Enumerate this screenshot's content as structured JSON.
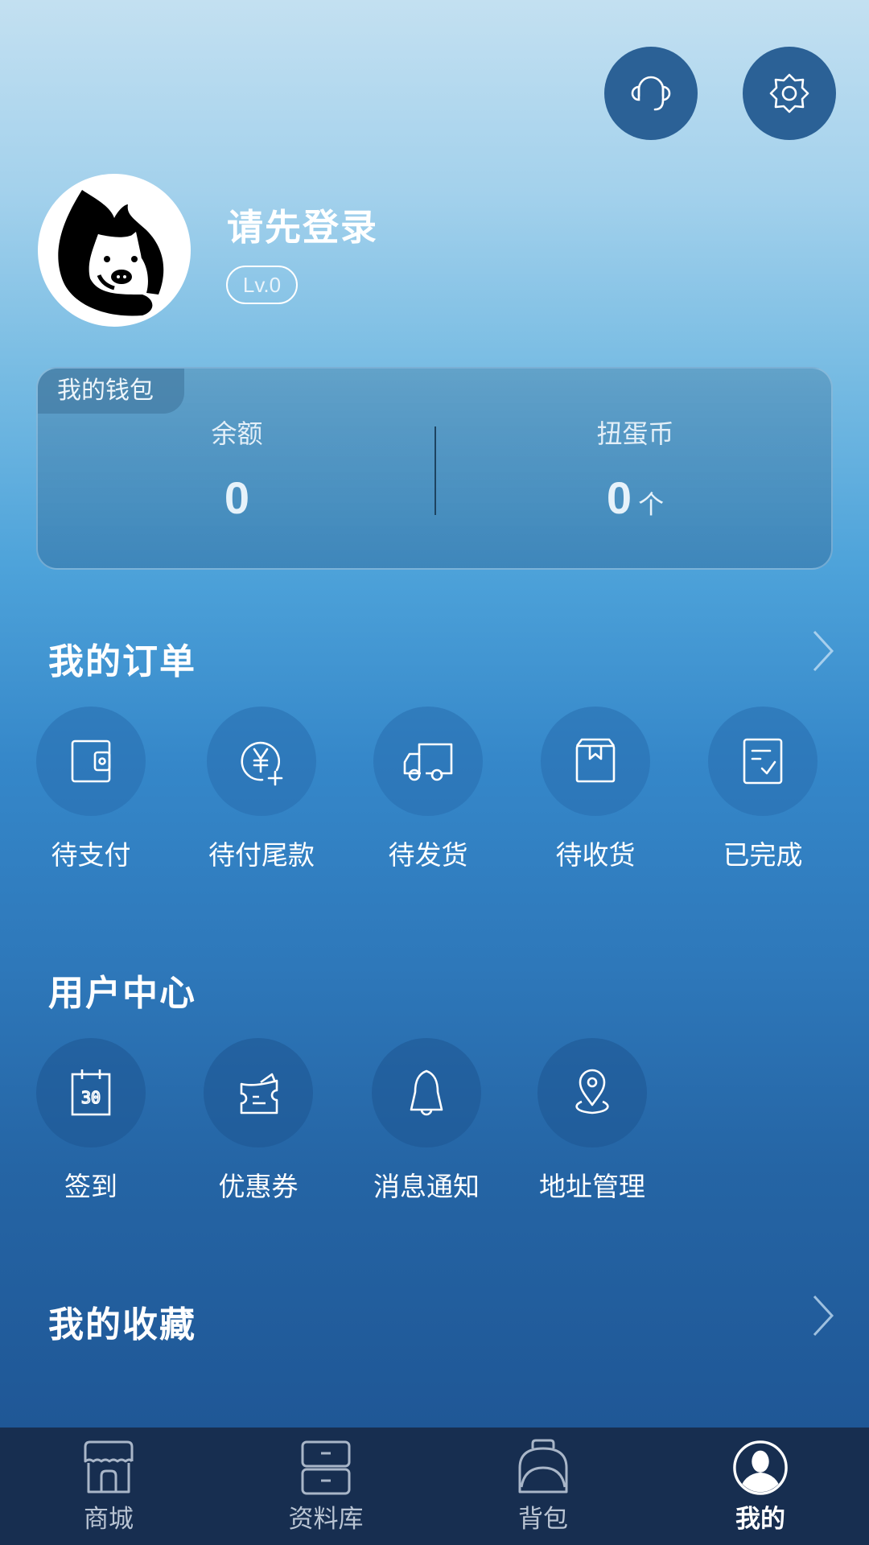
{
  "header": {
    "customer_service_icon": "headset-icon",
    "settings_icon": "gear-icon"
  },
  "profile": {
    "username": "请先登录",
    "level": "Lv.0",
    "avatar_icon": "pig-mascot-avatar"
  },
  "wallet": {
    "title": "我的钱包",
    "balance_label": "余额",
    "balance_value": "0",
    "coins_label": "扭蛋币",
    "coins_value": "0",
    "coins_unit": "个"
  },
  "orders": {
    "title": "我的订单",
    "items": [
      {
        "label": "待支付",
        "icon": "wallet-icon"
      },
      {
        "label": "待付尾款",
        "icon": "yen-plus-icon"
      },
      {
        "label": "待发货",
        "icon": "truck-icon"
      },
      {
        "label": "待收货",
        "icon": "package-icon"
      },
      {
        "label": "已完成",
        "icon": "checklist-icon"
      }
    ]
  },
  "user_center": {
    "title": "用户中心",
    "items": [
      {
        "label": "签到",
        "icon": "calendar-icon"
      },
      {
        "label": "优惠券",
        "icon": "coupon-icon"
      },
      {
        "label": "消息通知",
        "icon": "bell-icon"
      },
      {
        "label": "地址管理",
        "icon": "location-pin-icon"
      }
    ]
  },
  "favorites": {
    "title": "我的收藏"
  },
  "tabbar": {
    "active": "我的",
    "tabs": [
      {
        "label": "商城",
        "icon": "store-icon"
      },
      {
        "label": "资料库",
        "icon": "drawers-icon"
      },
      {
        "label": "背包",
        "icon": "backpack-icon"
      },
      {
        "label": "我的",
        "icon": "user-icon"
      }
    ]
  }
}
